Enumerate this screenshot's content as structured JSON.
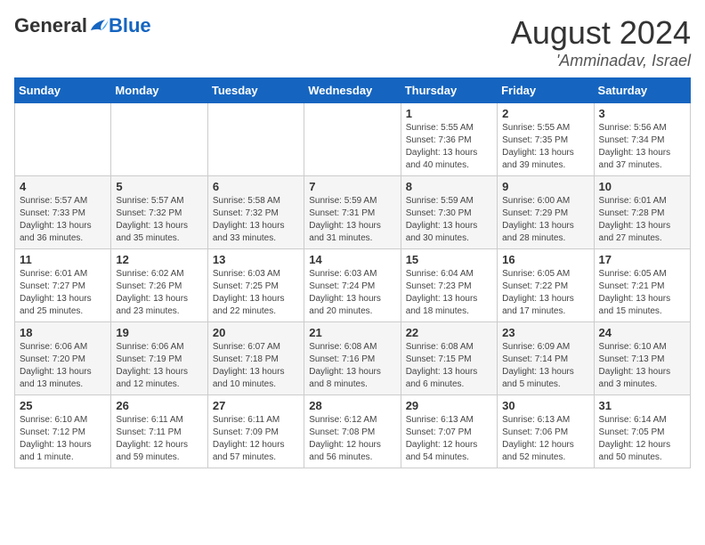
{
  "header": {
    "logo_general": "General",
    "logo_blue": "Blue",
    "month_year": "August 2024",
    "location": "'Amminadav, Israel"
  },
  "days_of_week": [
    "Sunday",
    "Monday",
    "Tuesday",
    "Wednesday",
    "Thursday",
    "Friday",
    "Saturday"
  ],
  "weeks": [
    [
      {
        "day": "",
        "info": ""
      },
      {
        "day": "",
        "info": ""
      },
      {
        "day": "",
        "info": ""
      },
      {
        "day": "",
        "info": ""
      },
      {
        "day": "1",
        "info": "Sunrise: 5:55 AM\nSunset: 7:36 PM\nDaylight: 13 hours\nand 40 minutes."
      },
      {
        "day": "2",
        "info": "Sunrise: 5:55 AM\nSunset: 7:35 PM\nDaylight: 13 hours\nand 39 minutes."
      },
      {
        "day": "3",
        "info": "Sunrise: 5:56 AM\nSunset: 7:34 PM\nDaylight: 13 hours\nand 37 minutes."
      }
    ],
    [
      {
        "day": "4",
        "info": "Sunrise: 5:57 AM\nSunset: 7:33 PM\nDaylight: 13 hours\nand 36 minutes."
      },
      {
        "day": "5",
        "info": "Sunrise: 5:57 AM\nSunset: 7:32 PM\nDaylight: 13 hours\nand 35 minutes."
      },
      {
        "day": "6",
        "info": "Sunrise: 5:58 AM\nSunset: 7:32 PM\nDaylight: 13 hours\nand 33 minutes."
      },
      {
        "day": "7",
        "info": "Sunrise: 5:59 AM\nSunset: 7:31 PM\nDaylight: 13 hours\nand 31 minutes."
      },
      {
        "day": "8",
        "info": "Sunrise: 5:59 AM\nSunset: 7:30 PM\nDaylight: 13 hours\nand 30 minutes."
      },
      {
        "day": "9",
        "info": "Sunrise: 6:00 AM\nSunset: 7:29 PM\nDaylight: 13 hours\nand 28 minutes."
      },
      {
        "day": "10",
        "info": "Sunrise: 6:01 AM\nSunset: 7:28 PM\nDaylight: 13 hours\nand 27 minutes."
      }
    ],
    [
      {
        "day": "11",
        "info": "Sunrise: 6:01 AM\nSunset: 7:27 PM\nDaylight: 13 hours\nand 25 minutes."
      },
      {
        "day": "12",
        "info": "Sunrise: 6:02 AM\nSunset: 7:26 PM\nDaylight: 13 hours\nand 23 minutes."
      },
      {
        "day": "13",
        "info": "Sunrise: 6:03 AM\nSunset: 7:25 PM\nDaylight: 13 hours\nand 22 minutes."
      },
      {
        "day": "14",
        "info": "Sunrise: 6:03 AM\nSunset: 7:24 PM\nDaylight: 13 hours\nand 20 minutes."
      },
      {
        "day": "15",
        "info": "Sunrise: 6:04 AM\nSunset: 7:23 PM\nDaylight: 13 hours\nand 18 minutes."
      },
      {
        "day": "16",
        "info": "Sunrise: 6:05 AM\nSunset: 7:22 PM\nDaylight: 13 hours\nand 17 minutes."
      },
      {
        "day": "17",
        "info": "Sunrise: 6:05 AM\nSunset: 7:21 PM\nDaylight: 13 hours\nand 15 minutes."
      }
    ],
    [
      {
        "day": "18",
        "info": "Sunrise: 6:06 AM\nSunset: 7:20 PM\nDaylight: 13 hours\nand 13 minutes."
      },
      {
        "day": "19",
        "info": "Sunrise: 6:06 AM\nSunset: 7:19 PM\nDaylight: 13 hours\nand 12 minutes."
      },
      {
        "day": "20",
        "info": "Sunrise: 6:07 AM\nSunset: 7:18 PM\nDaylight: 13 hours\nand 10 minutes."
      },
      {
        "day": "21",
        "info": "Sunrise: 6:08 AM\nSunset: 7:16 PM\nDaylight: 13 hours\nand 8 minutes."
      },
      {
        "day": "22",
        "info": "Sunrise: 6:08 AM\nSunset: 7:15 PM\nDaylight: 13 hours\nand 6 minutes."
      },
      {
        "day": "23",
        "info": "Sunrise: 6:09 AM\nSunset: 7:14 PM\nDaylight: 13 hours\nand 5 minutes."
      },
      {
        "day": "24",
        "info": "Sunrise: 6:10 AM\nSunset: 7:13 PM\nDaylight: 13 hours\nand 3 minutes."
      }
    ],
    [
      {
        "day": "25",
        "info": "Sunrise: 6:10 AM\nSunset: 7:12 PM\nDaylight: 13 hours\nand 1 minute."
      },
      {
        "day": "26",
        "info": "Sunrise: 6:11 AM\nSunset: 7:11 PM\nDaylight: 12 hours\nand 59 minutes."
      },
      {
        "day": "27",
        "info": "Sunrise: 6:11 AM\nSunset: 7:09 PM\nDaylight: 12 hours\nand 57 minutes."
      },
      {
        "day": "28",
        "info": "Sunrise: 6:12 AM\nSunset: 7:08 PM\nDaylight: 12 hours\nand 56 minutes."
      },
      {
        "day": "29",
        "info": "Sunrise: 6:13 AM\nSunset: 7:07 PM\nDaylight: 12 hours\nand 54 minutes."
      },
      {
        "day": "30",
        "info": "Sunrise: 6:13 AM\nSunset: 7:06 PM\nDaylight: 12 hours\nand 52 minutes."
      },
      {
        "day": "31",
        "info": "Sunrise: 6:14 AM\nSunset: 7:05 PM\nDaylight: 12 hours\nand 50 minutes."
      }
    ]
  ]
}
